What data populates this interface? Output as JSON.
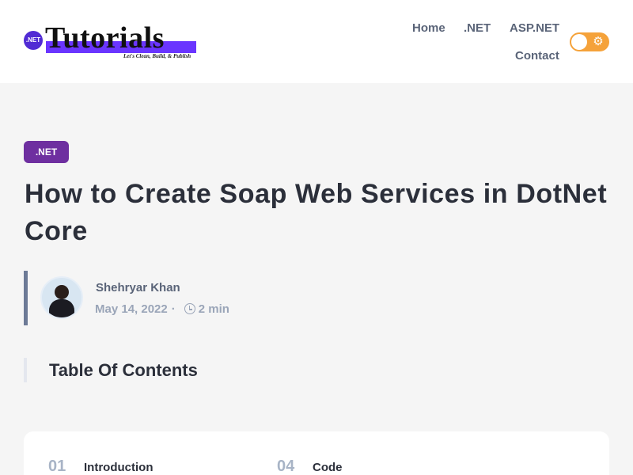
{
  "logo": {
    "badge": ".NET",
    "word": "Tutorials",
    "tagline": "Let's Clean, Build, & Publish"
  },
  "nav": {
    "items": [
      {
        "label": "Home"
      },
      {
        "label": ".NET"
      },
      {
        "label": "ASP.NET"
      },
      {
        "label": "Contact"
      }
    ]
  },
  "theme_toggle": {
    "state": "light",
    "icon": "sun-icon",
    "color": "#f5a23a"
  },
  "post": {
    "category": ".NET",
    "category_color": "#6e2fa0",
    "title": "How to Create Soap Web Services in DotNet Core",
    "author": "Shehryar Khan",
    "date": "May 14, 2022",
    "separator": "·",
    "read_time": "2 min"
  },
  "toc": {
    "heading": "Table Of Contents",
    "items": [
      {
        "num": "01",
        "label": "Introduction"
      },
      {
        "num": "04",
        "label": "Code"
      }
    ]
  }
}
